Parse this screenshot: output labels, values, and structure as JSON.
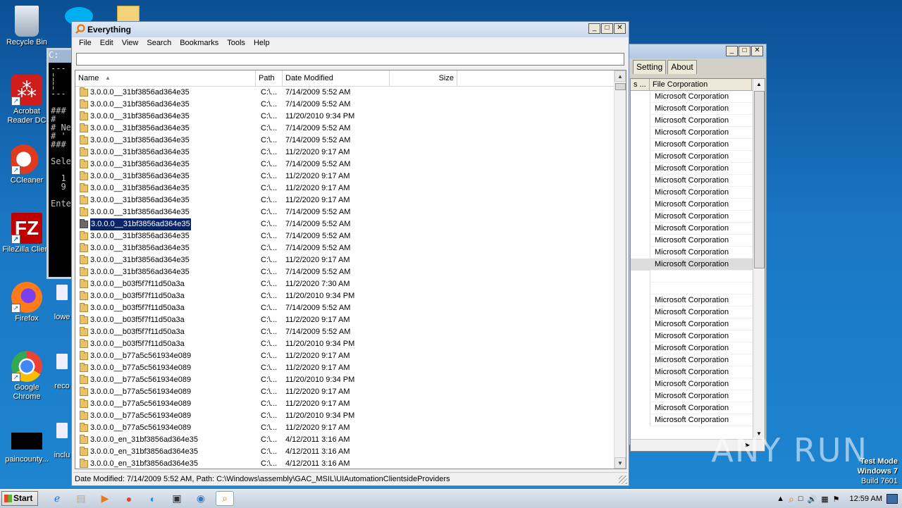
{
  "desktop": {
    "icons": [
      {
        "label": "Recycle Bin"
      },
      {
        "label": "Acrobat Reader DC"
      },
      {
        "label": "CCleaner"
      },
      {
        "label": "FileZilla Client"
      },
      {
        "label": "Firefox"
      },
      {
        "label": "Google Chrome"
      },
      {
        "label": "paincounty..."
      }
    ],
    "partial_labels": [
      "lowe",
      "reco",
      "inclu"
    ]
  },
  "everything_window": {
    "title": "Everything",
    "menu": [
      "File",
      "Edit",
      "View",
      "Search",
      "Bookmarks",
      "Tools",
      "Help"
    ],
    "search_value": "",
    "columns": {
      "name": "Name",
      "path": "Path",
      "date": "Date Modified",
      "size": "Size"
    },
    "rows": [
      {
        "name": "3.0.0.0__31bf3856ad364e35",
        "path": "C:\\...",
        "date": "7/14/2009 5:52 AM"
      },
      {
        "name": "3.0.0.0__31bf3856ad364e35",
        "path": "C:\\...",
        "date": "7/14/2009 5:52 AM"
      },
      {
        "name": "3.0.0.0__31bf3856ad364e35",
        "path": "C:\\...",
        "date": "11/20/2010 9:34 PM"
      },
      {
        "name": "3.0.0.0__31bf3856ad364e35",
        "path": "C:\\...",
        "date": "7/14/2009 5:52 AM"
      },
      {
        "name": "3.0.0.0__31bf3856ad364e35",
        "path": "C:\\...",
        "date": "7/14/2009 5:52 AM"
      },
      {
        "name": "3.0.0.0__31bf3856ad364e35",
        "path": "C:\\...",
        "date": "11/2/2020 9:17 AM"
      },
      {
        "name": "3.0.0.0__31bf3856ad364e35",
        "path": "C:\\...",
        "date": "7/14/2009 5:52 AM"
      },
      {
        "name": "3.0.0.0__31bf3856ad364e35",
        "path": "C:\\...",
        "date": "11/2/2020 9:17 AM"
      },
      {
        "name": "3.0.0.0__31bf3856ad364e35",
        "path": "C:\\...",
        "date": "11/2/2020 9:17 AM"
      },
      {
        "name": "3.0.0.0__31bf3856ad364e35",
        "path": "C:\\...",
        "date": "11/2/2020 9:17 AM"
      },
      {
        "name": "3.0.0.0__31bf3856ad364e35",
        "path": "C:\\...",
        "date": "7/14/2009 5:52 AM"
      },
      {
        "name": "3.0.0.0__31bf3856ad364e35",
        "path": "C:\\...",
        "date": "7/14/2009 5:52 AM",
        "selected": true
      },
      {
        "name": "3.0.0.0__31bf3856ad364e35",
        "path": "C:\\...",
        "date": "7/14/2009 5:52 AM"
      },
      {
        "name": "3.0.0.0__31bf3856ad364e35",
        "path": "C:\\...",
        "date": "7/14/2009 5:52 AM"
      },
      {
        "name": "3.0.0.0__31bf3856ad364e35",
        "path": "C:\\...",
        "date": "11/2/2020 9:17 AM"
      },
      {
        "name": "3.0.0.0__31bf3856ad364e35",
        "path": "C:\\...",
        "date": "7/14/2009 5:52 AM"
      },
      {
        "name": "3.0.0.0__b03f5f7f11d50a3a",
        "path": "C:\\...",
        "date": "11/2/2020 7:30 AM"
      },
      {
        "name": "3.0.0.0__b03f5f7f11d50a3a",
        "path": "C:\\...",
        "date": "11/20/2010 9:34 PM"
      },
      {
        "name": "3.0.0.0__b03f5f7f11d50a3a",
        "path": "C:\\...",
        "date": "7/14/2009 5:52 AM"
      },
      {
        "name": "3.0.0.0__b03f5f7f11d50a3a",
        "path": "C:\\...",
        "date": "11/2/2020 9:17 AM"
      },
      {
        "name": "3.0.0.0__b03f5f7f11d50a3a",
        "path": "C:\\...",
        "date": "7/14/2009 5:52 AM"
      },
      {
        "name": "3.0.0.0__b03f5f7f11d50a3a",
        "path": "C:\\...",
        "date": "11/20/2010 9:34 PM"
      },
      {
        "name": "3.0.0.0__b77a5c561934e089",
        "path": "C:\\...",
        "date": "11/2/2020 9:17 AM"
      },
      {
        "name": "3.0.0.0__b77a5c561934e089",
        "path": "C:\\...",
        "date": "11/2/2020 9:17 AM"
      },
      {
        "name": "3.0.0.0__b77a5c561934e089",
        "path": "C:\\...",
        "date": "11/20/2010 9:34 PM"
      },
      {
        "name": "3.0.0.0__b77a5c561934e089",
        "path": "C:\\...",
        "date": "11/2/2020 9:17 AM"
      },
      {
        "name": "3.0.0.0__b77a5c561934e089",
        "path": "C:\\...",
        "date": "11/2/2020 9:17 AM"
      },
      {
        "name": "3.0.0.0__b77a5c561934e089",
        "path": "C:\\...",
        "date": "11/20/2010 9:34 PM"
      },
      {
        "name": "3.0.0.0__b77a5c561934e089",
        "path": "C:\\...",
        "date": "11/2/2020 9:17 AM"
      },
      {
        "name": "3.0.0.0_en_31bf3856ad364e35",
        "path": "C:\\...",
        "date": "4/12/2011 3:16 AM"
      },
      {
        "name": "3.0.0.0_en_31bf3856ad364e35",
        "path": "C:\\...",
        "date": "4/12/2011 3:16 AM"
      },
      {
        "name": "3.0.0.0_en_31bf3856ad364e35",
        "path": "C:\\...",
        "date": "4/12/2011 3:16 AM"
      }
    ],
    "status": "Date Modified: 7/14/2009 5:52 AM, Path: C:\\Windows\\assembly\\GAC_MSIL\\UIAutomationClientsideProviders"
  },
  "props_window": {
    "tabs": [
      "Setting",
      "About"
    ],
    "column_header": "File Corporation",
    "truncated_header": "s ...",
    "rows": [
      "Microsoft Corporation",
      "Microsoft Corporation",
      "Microsoft Corporation",
      "Microsoft Corporation",
      "Microsoft Corporation",
      "Microsoft Corporation",
      "Microsoft Corporation",
      "Microsoft Corporation",
      "Microsoft Corporation",
      "Microsoft Corporation",
      "Microsoft Corporation",
      "Microsoft Corporation",
      "Microsoft Corporation",
      "Microsoft Corporation",
      "Microsoft Corporation",
      "",
      "",
      "Microsoft Corporation",
      "Microsoft Corporation",
      "Microsoft Corporation",
      "Microsoft Corporation",
      "Microsoft Corporation",
      "Microsoft Corporation",
      "Microsoft Corporation",
      "Microsoft Corporation",
      "Microsoft Corporation",
      "Microsoft Corporation",
      "Microsoft Corporation"
    ],
    "selected_index": 14
  },
  "console_window": {
    "title_fragment": "C:",
    "lines": [
      "---",
      "¦",
      "¦",
      "---",
      "",
      "###",
      "#",
      "# Ne",
      "# '",
      "###",
      "",
      "Sele",
      "",
      "  1",
      "  9",
      "",
      "Ente"
    ]
  },
  "taskbar": {
    "start_label": "Start",
    "clock": "12:59 AM"
  },
  "overlay": {
    "watermark": "ANY RUN",
    "test_mode": "Test Mode",
    "os": "Windows 7",
    "build": "Build 7601"
  }
}
